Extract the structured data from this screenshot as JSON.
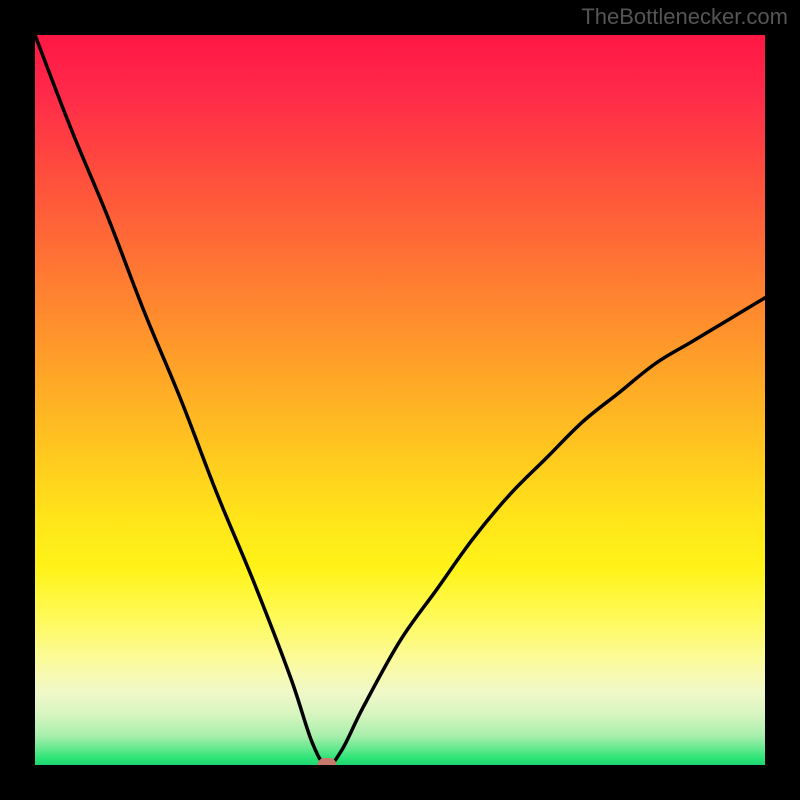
{
  "attribution": "TheBottlenecker.com",
  "chart_data": {
    "type": "line",
    "title": "",
    "xlabel": "",
    "ylabel": "",
    "x_range": [
      0,
      100
    ],
    "y_range": [
      0,
      100
    ],
    "gradient_meaning": "bottleneck severity (top=high/red, bottom=low/green)",
    "series": [
      {
        "name": "bottleneck-curve",
        "x": [
          0,
          5,
          10,
          15,
          20,
          25,
          30,
          35,
          38,
          40,
          42,
          45,
          50,
          55,
          60,
          65,
          70,
          75,
          80,
          85,
          90,
          95,
          100
        ],
        "values": [
          100,
          87,
          75,
          62,
          50,
          37,
          25,
          12,
          3,
          0,
          2,
          8,
          17,
          24,
          31,
          37,
          42,
          47,
          51,
          55,
          58,
          61,
          64
        ]
      }
    ],
    "optimum_marker": {
      "x": 40,
      "y": 0
    }
  },
  "colors": {
    "frame": "#000000",
    "curve": "#000000",
    "marker": "#c77a6b"
  }
}
